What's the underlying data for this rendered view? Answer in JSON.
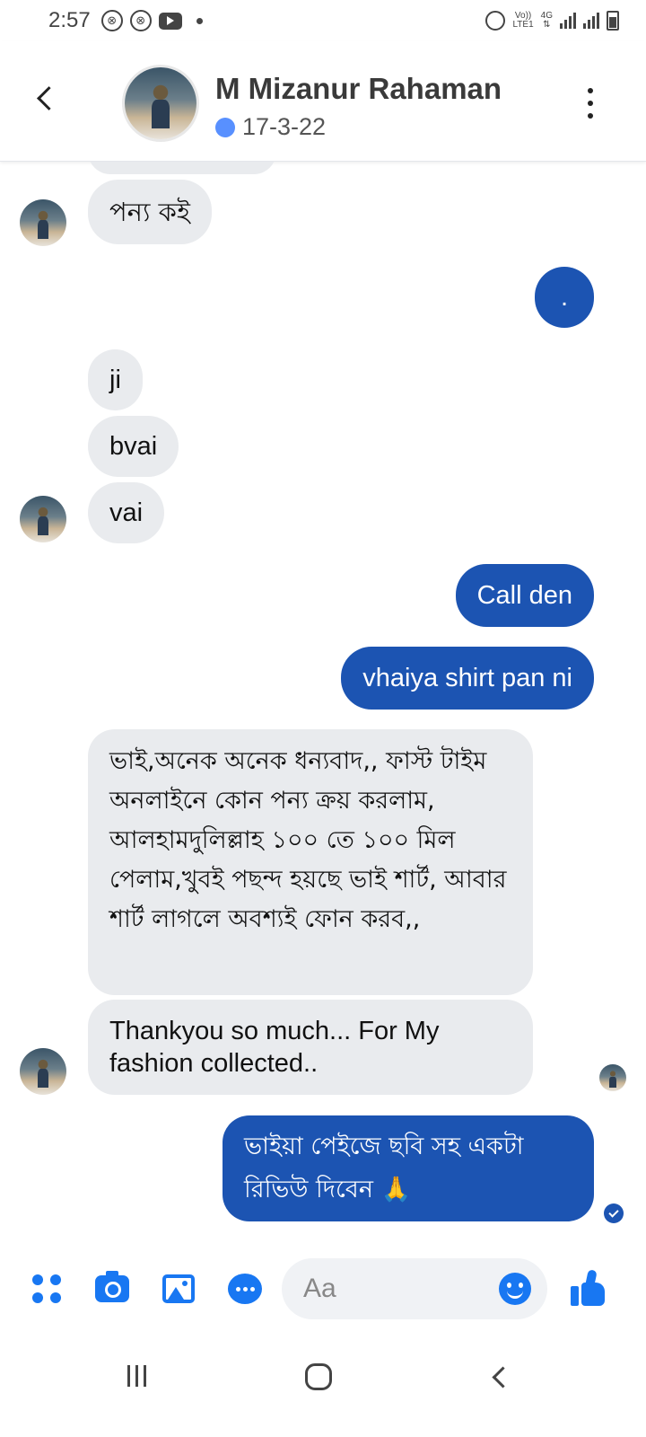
{
  "status_bar": {
    "time": "2:57",
    "network_top": "Vo))",
    "network_bottom": "LTE1",
    "network_type": "4G"
  },
  "header": {
    "contact_name": "M Mizanur Rahaman",
    "active_status": "17-3-22",
    "active_dot_color": "#5890ff"
  },
  "messages": [
    {
      "direction": "in",
      "text": "পন্য কই"
    },
    {
      "direction": "out",
      "text": "."
    },
    {
      "direction": "in",
      "text": "ji"
    },
    {
      "direction": "in",
      "text": "bvai"
    },
    {
      "direction": "in",
      "text": "vai"
    },
    {
      "direction": "out",
      "text": "Call den"
    },
    {
      "direction": "out",
      "text": "vhaiya shirt pan ni"
    },
    {
      "direction": "in",
      "text": "ভাই,অনেক অনেক ধন্যবাদ,,  ফাস্ট টাইম অনলাইনে কোন পন্য ক্রয় করলাম,  আলহামদুলিল্লাহ ১০০ তে ১০০ মিল পেলাম,খুবই পছন্দ হয়ছে ভাই শার্ট,    আবার শার্ট লাগলে অবশ্যই   ফোন   করব,,"
    },
    {
      "direction": "in",
      "text": "Thankyou  so much...  For My fashion collected.."
    },
    {
      "direction": "out",
      "text": "ভাইয়া পেইজে ছবি সহ একটা রিভিউ দিবেন 🙏"
    }
  ],
  "composer": {
    "placeholder": "Aa"
  },
  "colors": {
    "outgoing_bubble": "#1c54b2",
    "incoming_bubble": "#e9ebee",
    "accent": "#1877f2"
  }
}
